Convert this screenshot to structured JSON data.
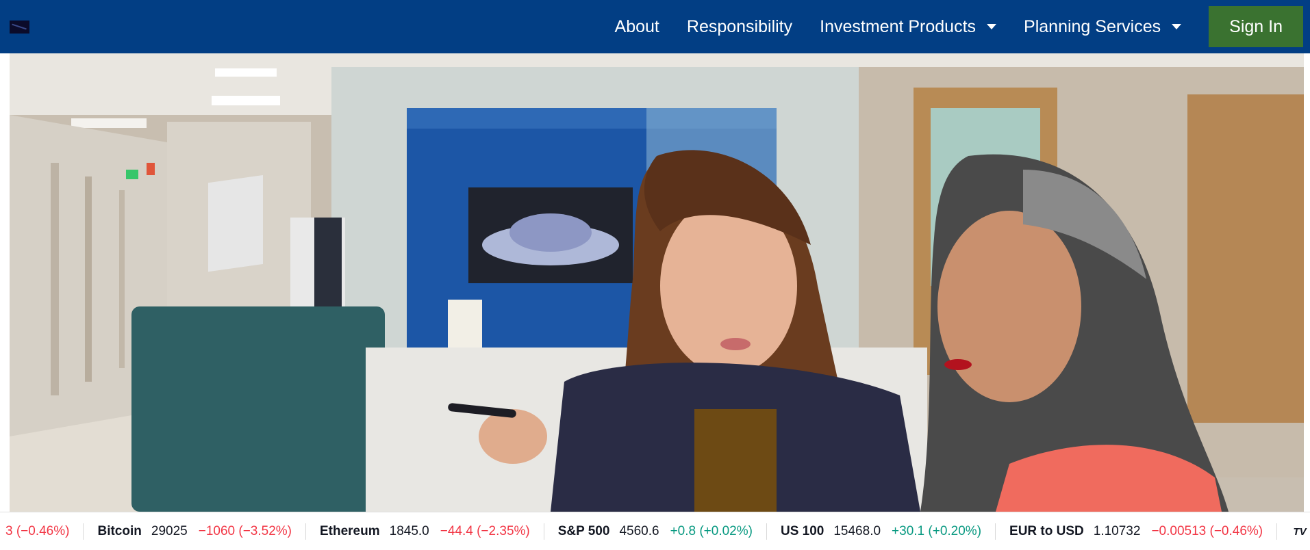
{
  "nav": {
    "links": [
      {
        "label": "About"
      },
      {
        "label": "Responsibility"
      },
      {
        "label": "Investment Products",
        "dropdown": true
      },
      {
        "label": "Planning Services",
        "dropdown": true
      }
    ],
    "signin_label": "Sign In",
    "colors": {
      "navbar": "#023e84",
      "signin": "#3a7230"
    }
  },
  "hero": {
    "icon": "office-photo"
  },
  "ticker": {
    "leading_partial_change": "3 (−0.46%)",
    "items": [
      {
        "name": "Bitcoin",
        "value": "29025",
        "change": "−1060 (−3.52%)",
        "direction": "down"
      },
      {
        "name": "Ethereum",
        "value": "1845.0",
        "change": "−44.4 (−2.35%)",
        "direction": "down"
      },
      {
        "name": "S&P 500",
        "value": "4560.6",
        "change": "+0.8 (+0.02%)",
        "direction": "up"
      },
      {
        "name": "US 100",
        "value": "15468.0",
        "change": "+30.1 (+0.20%)",
        "direction": "up"
      },
      {
        "name": "EUR to USD",
        "value": "1.10732",
        "change": "−0.00513 (−0.46%)",
        "direction": "down"
      }
    ],
    "logo_text": "TV",
    "colors": {
      "down": "#f23645",
      "up": "#089981"
    }
  }
}
